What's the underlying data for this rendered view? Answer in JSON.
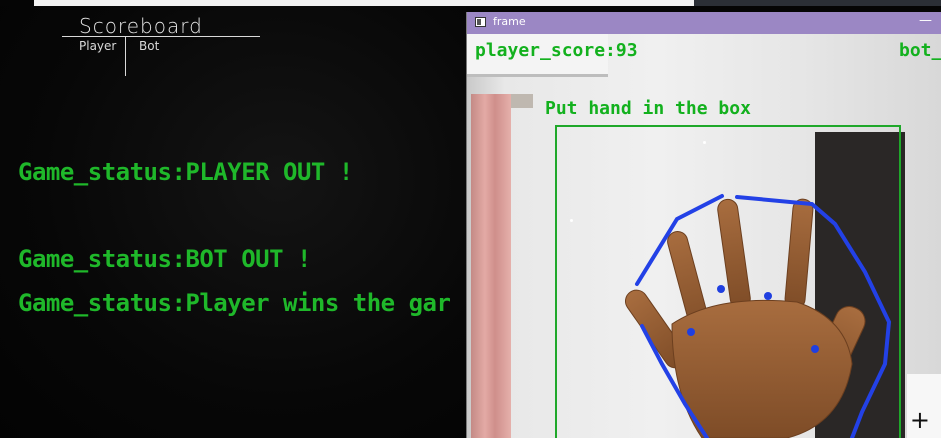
{
  "scoreboard": {
    "title": "Scoreboard",
    "col_player": "Player",
    "col_bot": "Bot",
    "status_lines": [
      "Game_status:PLAYER OUT !",
      "Game_status:BOT OUT !",
      "Game_status:Player wins the gar"
    ]
  },
  "frame": {
    "title": "frame",
    "minimize": "—",
    "player_score": "player_score:93",
    "bot_score": "bot_",
    "instruction": "Put hand in the box",
    "expand": "+"
  },
  "colors": {
    "overlay_text": "#13b11e",
    "hull": "#2341e6",
    "titlebar": "#9b87c4"
  }
}
